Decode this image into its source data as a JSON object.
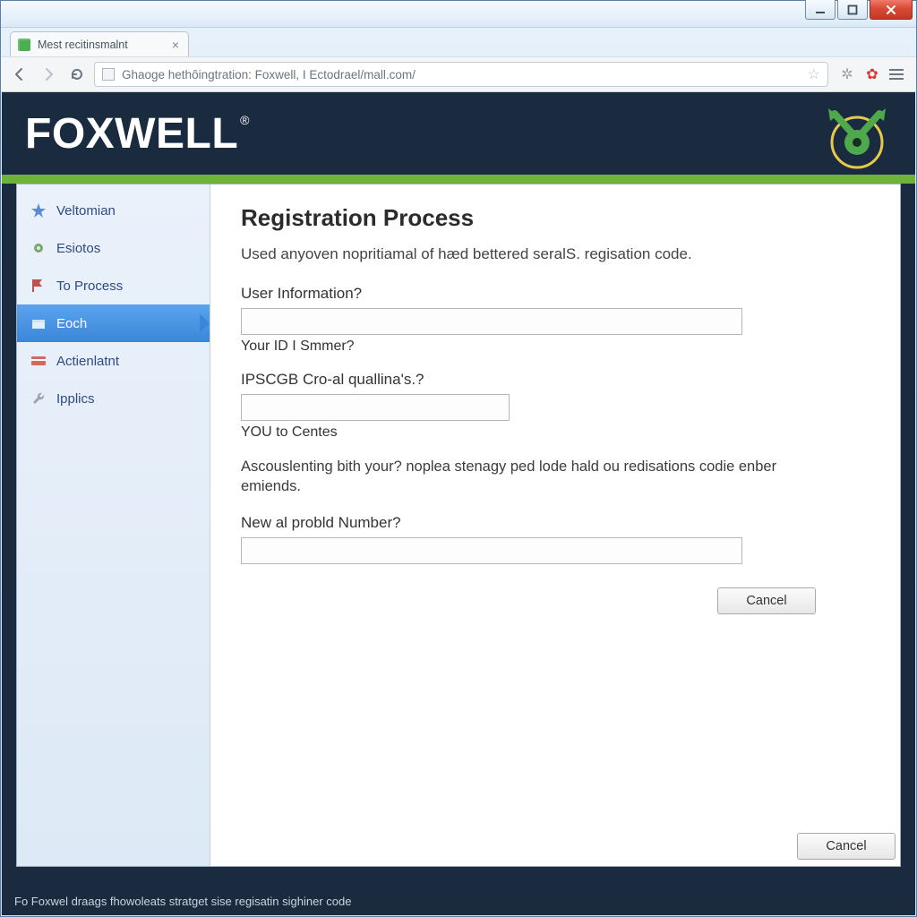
{
  "window": {
    "tab_title": "Mest recitinsmalnt",
    "url": "Ghaoge hethôingtration: Foxwell, I Ectodrael/mall.com/"
  },
  "brand": {
    "name": "FOXWELL",
    "registered": "®"
  },
  "sidebar": {
    "items": [
      {
        "label": "Veltomian",
        "icon": "star-icon",
        "active": false
      },
      {
        "label": "Esiotos",
        "icon": "gear-icon",
        "active": false
      },
      {
        "label": "To Process",
        "icon": "flag-icon",
        "active": false
      },
      {
        "label": "Eoch",
        "icon": "box-icon",
        "active": true
      },
      {
        "label": "Actienlatnt",
        "icon": "card-icon",
        "active": false
      },
      {
        "label": "Ipplics",
        "icon": "wrench-icon",
        "active": false
      }
    ]
  },
  "form": {
    "heading": "Registration Process",
    "intro": "Used anyoven nopritiamal of hæd bettered seralS. regisation code.",
    "label_user_info": "User Information?",
    "sub_user_info": "Your ID I Smmer?",
    "label_ipscg": "IPSCGB Cro-al quallina's.?",
    "sub_ipscg": "YOU to Centes",
    "para": "Ascouslenting bith your? noplea stenagy ped lode hald ou redisations codie enber emiends.",
    "label_prod_num": "New al probld Number?",
    "cancel_inner": "Cancel"
  },
  "outer_cancel": "Cancel",
  "status_text": "Fo Foxwel draags fhowoleats stratget sise regisatin sighiner code"
}
